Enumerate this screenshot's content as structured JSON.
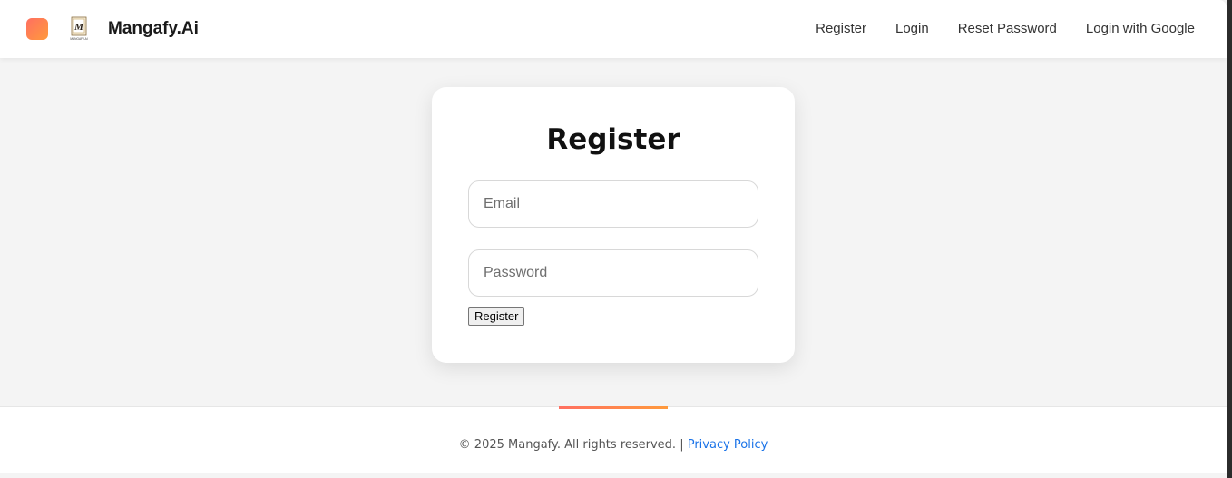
{
  "header": {
    "brand": "Mangafy.Ai",
    "logo_text": "MANGAFY.AI",
    "nav": {
      "register": "Register",
      "login": "Login",
      "reset_password": "Reset Password",
      "login_google": "Login with Google"
    }
  },
  "form": {
    "title": "Register",
    "email_placeholder": "Email",
    "password_placeholder": "Password",
    "submit_label": "Register"
  },
  "footer": {
    "copyright": "© 2025 Mangafy. All rights reserved. |",
    "privacy_link": "Privacy Policy"
  },
  "colors": {
    "accent_start": "#ff6f61",
    "accent_end": "#ff9a3c",
    "link": "#1a73e8",
    "background": "#f4f4f4"
  },
  "icons": {
    "app_icon": "orange-square-icon",
    "logo": "mangafy-logo"
  }
}
